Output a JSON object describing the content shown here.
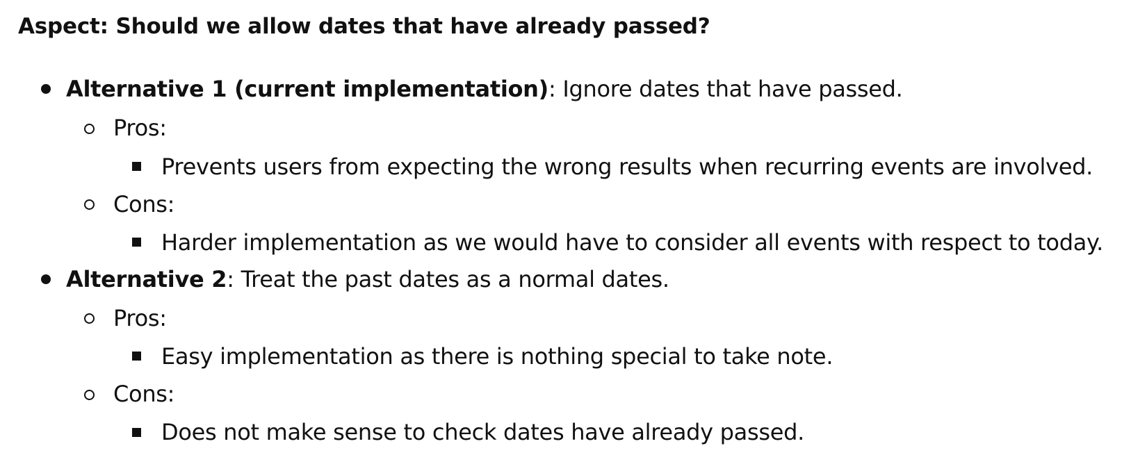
{
  "heading": "Aspect: Should we allow dates that have already passed?",
  "alternatives": [
    {
      "title": "Alternative 1 (current implementation)",
      "description": ": Ignore dates that have passed.",
      "pros_label": "Pros:",
      "pros_item": "Prevents users from expecting the wrong results when recurring events are involved.",
      "cons_label": "Cons:",
      "cons_item": "Harder implementation as we would have to consider all events with respect to today."
    },
    {
      "title": "Alternative 2",
      "description": ": Treat the past dates as a normal dates.",
      "pros_label": "Pros:",
      "pros_item": "Easy implementation as there is nothing special to take note.",
      "cons_label": "Cons:",
      "cons_item": "Does not make sense to check dates have already passed."
    }
  ]
}
